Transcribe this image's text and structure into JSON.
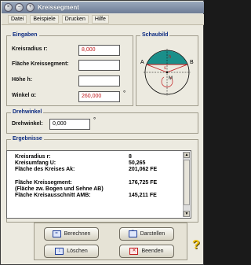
{
  "window": {
    "title": "Kreissegment",
    "close_glyph": "×",
    "min_glyph": "–",
    "zoom_glyph": "+"
  },
  "menu": [
    "Datei",
    "Beispiele",
    "Drucken",
    "Hilfe"
  ],
  "eingaben": {
    "legend": "Eingaben",
    "fields": [
      {
        "label": "Kreisradius r:",
        "value": "8,000"
      },
      {
        "label": "Fläche Kreissegment:",
        "value": ""
      },
      {
        "label": "Höhe h:",
        "value": ""
      },
      {
        "label": "Winkel α:",
        "value": "260,000"
      }
    ],
    "degree": "°"
  },
  "schaubild": {
    "legend": "Schaubild",
    "labels": {
      "A": "A",
      "B": "B",
      "M": "M",
      "h": "h",
      "s": "s"
    }
  },
  "drehwinkel": {
    "legend": "Drehwinkel",
    "label": "Drehwinkel:",
    "value": "0,000",
    "degree": "°"
  },
  "ergebnisse": {
    "legend": "Ergebnisse",
    "lines": [
      {
        "label": "Kreisradius r:",
        "value": "8"
      },
      {
        "label": "Kreisumfang U:",
        "value": "50,265"
      },
      {
        "label": "Fläche des Kreises Ak:",
        "value": "201,062 FE"
      },
      {
        "label": "",
        "value": ""
      },
      {
        "label": "Fläche Kreissegment:",
        "value": "176,725 FE"
      },
      {
        "label": "(Fläche zw. Bogen und Sehne AB)",
        "value": ""
      },
      {
        "label": "Fläche Kreisausschnitt AMB:",
        "value": "145,211 FE"
      }
    ]
  },
  "buttons": {
    "berechnen": "Berechnen",
    "darstellen": "Darstellen",
    "loeschen": "Löschen",
    "beenden": "Beenden",
    "help": "?"
  },
  "colors": {
    "accent_blue": "#0b2a80",
    "input_red": "#c0191c",
    "segment_teal": "#1a8f8a"
  }
}
